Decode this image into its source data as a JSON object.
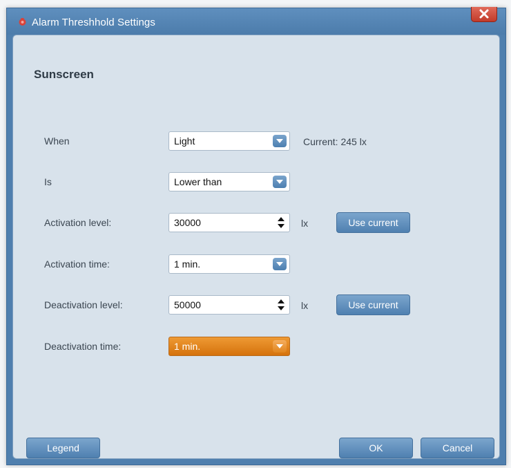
{
  "window": {
    "title": "Alarm Threshhold Settings"
  },
  "section": {
    "title": "Sunscreen"
  },
  "rows": {
    "when": {
      "label": "When",
      "value": "Light",
      "current_label": "Current:",
      "current_value": "245 lx"
    },
    "is": {
      "label": "Is",
      "value": "Lower than"
    },
    "activation_level": {
      "label": "Activation level:",
      "value": "30000",
      "unit": "lx",
      "button": "Use current"
    },
    "activation_time": {
      "label": "Activation time:",
      "value": "1 min."
    },
    "deactivation_level": {
      "label": "Deactivation level:",
      "value": "50000",
      "unit": "lx",
      "button": "Use current"
    },
    "deactivation_time": {
      "label": "Deactivation time:",
      "value": "1 min."
    }
  },
  "footer": {
    "legend": "Legend",
    "ok": "OK",
    "cancel": "Cancel"
  },
  "icons": {
    "title": "alarm-icon",
    "close": "close-icon",
    "dropdown": "chevron-down-icon",
    "spinner": "spinner-arrows-icon"
  },
  "colors": {
    "title_bar": "#4f7fae",
    "client_bg": "#d8e2eb",
    "button": "#5f8fbe",
    "active_field": "#e8891f",
    "close": "#d0503e"
  }
}
